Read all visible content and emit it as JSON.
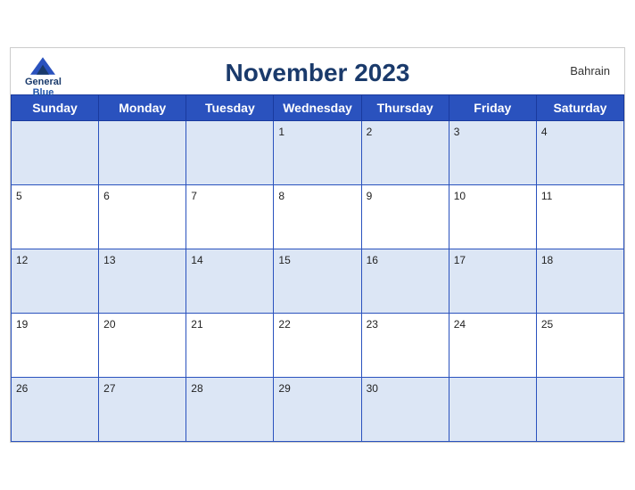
{
  "header": {
    "title": "November 2023",
    "country": "Bahrain",
    "logo_general": "General",
    "logo_blue": "Blue"
  },
  "days_of_week": [
    "Sunday",
    "Monday",
    "Tuesday",
    "Wednesday",
    "Thursday",
    "Friday",
    "Saturday"
  ],
  "weeks": [
    [
      "",
      "",
      "",
      "1",
      "2",
      "3",
      "4"
    ],
    [
      "5",
      "6",
      "7",
      "8",
      "9",
      "10",
      "11"
    ],
    [
      "12",
      "13",
      "14",
      "15",
      "16",
      "17",
      "18"
    ],
    [
      "19",
      "20",
      "21",
      "22",
      "23",
      "24",
      "25"
    ],
    [
      "26",
      "27",
      "28",
      "29",
      "30",
      "",
      ""
    ]
  ]
}
